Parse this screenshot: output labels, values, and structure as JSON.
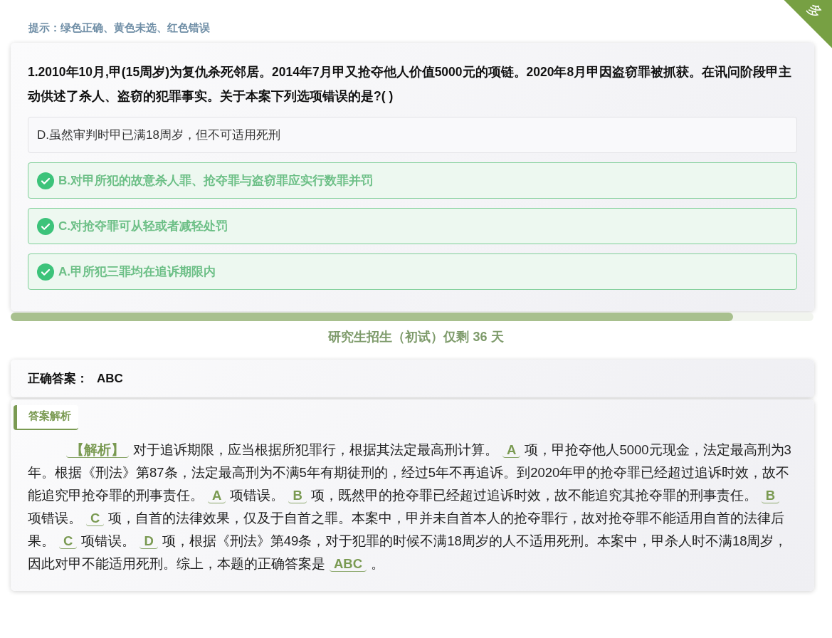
{
  "hint": "提示：绿色正确、黄色未选、红色错误",
  "corner_tag": "多",
  "question": {
    "text": "1.2010年10月,甲(15周岁)为复仇杀死邻居。2014年7月甲又抢夺他人价值5000元的项链。2020年8月甲因盗窃罪被抓获。在讯问阶段甲主动供述了杀人、盗窃的犯罪事实。关于本案下列选项错误的是?( )",
    "options": [
      {
        "text": "D.虽然审判时甲已满18周岁，但不可适用死刑",
        "correct": false
      },
      {
        "text": "B.对甲所犯的故意杀人罪、抢夺罪与盗窃罪应实行数罪并罚",
        "correct": true
      },
      {
        "text": "C.对抢夺罪可从轻或者减轻处罚",
        "correct": true
      },
      {
        "text": "A.甲所犯三罪均在追诉期限内",
        "correct": true
      }
    ]
  },
  "progress": {
    "level": 0.9
  },
  "countdown": "研究生招生（初试）仅剩 36 天",
  "answer": {
    "label": "正确答案：",
    "value": "ABC"
  },
  "analysis": {
    "tab": "答案解析",
    "segments": [
      {
        "kind": "keyword",
        "text": "【解析】"
      },
      {
        "kind": "plain",
        "text": "对于追诉期限，应当根据所犯罪行，根据其法定最高刑计算。"
      },
      {
        "kind": "keyword",
        "text": "A"
      },
      {
        "kind": "plain",
        "text": "项，甲抢夺他人5000元现金，法定最高刑为3年。根据《刑法》第87条，法定最高刑为不满5年有期徒刑的，经过5年不再追诉。到2020年甲的抢夺罪已经超过追诉时效，故不能追究甲抢夺罪的刑事责任。"
      },
      {
        "kind": "keyword",
        "text": "A"
      },
      {
        "kind": "plain",
        "text": "项错误。"
      },
      {
        "kind": "keyword",
        "text": "B"
      },
      {
        "kind": "plain",
        "text": "项，既然甲的抢夺罪已经超过追诉时效，故不能追究其抢夺罪的刑事责任。"
      },
      {
        "kind": "keyword",
        "text": "B"
      },
      {
        "kind": "plain",
        "text": "项错误。"
      },
      {
        "kind": "keyword",
        "text": "C"
      },
      {
        "kind": "plain",
        "text": "项，自首的法律效果，仅及于自首之罪。本案中，甲并未自首本人的抢夺罪行，故对抢夺罪不能适用自首的法律后果。"
      },
      {
        "kind": "keyword",
        "text": "C"
      },
      {
        "kind": "plain",
        "text": "项错误。"
      },
      {
        "kind": "keyword",
        "text": "D"
      },
      {
        "kind": "plain",
        "text": "项，根据《刑法》第49条，对于犯罪的时候不满18周岁的人不适用死刑。本案中，甲杀人时不满18周岁，因此对甲不能适用死刑。综上，本题的正确答案是"
      },
      {
        "kind": "keyword",
        "text": "ABC"
      },
      {
        "kind": "plain",
        "text": "。"
      }
    ]
  }
}
